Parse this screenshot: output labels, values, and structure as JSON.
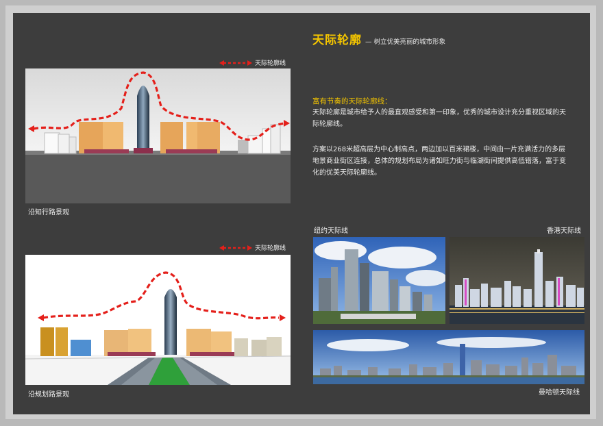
{
  "header": {
    "title": "天际轮廓",
    "subtitle": "— 树立优美亮丽的城市形象"
  },
  "intro": {
    "heading": "富有节奏的天际轮廓线：",
    "paragraph1": "天际轮廓是城市给予人的最直观感受和第一印象，优秀的城市设计充分重视区域的天际轮廓线。",
    "paragraph2": "方案以268米超高层为中心制高点，两边加以百米裙楼，中间由一片充满活力的多层地景商业街区连接，总体的规划布局为诸如旺力街与临湖街间提供高低错落，富于变化的优美天际轮廓线。"
  },
  "diagrams": {
    "legend_label": "天际轮廓线",
    "top_caption": "沿知行路景观",
    "bottom_caption": "沿规划路景观"
  },
  "references": {
    "ny_caption": "纽约天际线",
    "hk_caption": "香港天际线",
    "manhattan_caption": "曼哈顿天际线"
  },
  "colors": {
    "accent_yellow": "#f3c400",
    "skyline_red": "#e4201b",
    "background": "#3d3d3d"
  }
}
